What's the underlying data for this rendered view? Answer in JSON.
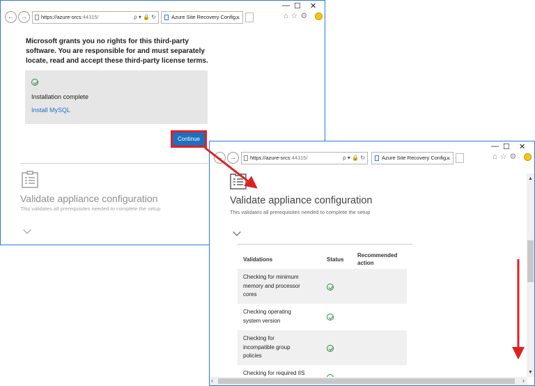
{
  "browser": {
    "url_host": "https://azure-srcs",
    "url_port": ":44315/",
    "url_tools": "ρ ▾ 🔒 ↻",
    "tab_title": "Azure Site Recovery Config...",
    "tab_close": "×",
    "nav_back": "←",
    "nav_forward": "→",
    "minimize": "—",
    "maximize": "☐",
    "close": "✕",
    "right_icons": "⌂☆⚙"
  },
  "install": {
    "license_text": "Microsoft grants you no rights for this third-party software. You are responsible for and must separately locate, read and accept these third-party license terms.",
    "status": "Installation complete",
    "install_link": "Install MySQL",
    "continue_label": "Continue"
  },
  "validate": {
    "title": "Validate appliance configuration",
    "subtitle": "This validates all prerequisites needed to complete the setup"
  },
  "table": {
    "headers": {
      "validations": "Validations",
      "status": "Status",
      "action_line1": "Recommended",
      "action_line2": "action"
    },
    "rows": [
      {
        "line1": "Checking for minimum",
        "line2": "memory and processor",
        "line3": "cores",
        "status": "passed"
      },
      {
        "line1": "Checking operating",
        "line2": "system version",
        "line3": "",
        "status": "passed"
      },
      {
        "line1": "Checking for",
        "line2": "incompatible group",
        "line3": "policies",
        "status": "passed"
      },
      {
        "line1": "Checking for required IIS",
        "line2": "",
        "line3": "",
        "status": "passed"
      }
    ]
  },
  "scrollbar": {
    "left_arrow": "‹",
    "right_arrow": "›",
    "up_arrow": "▲",
    "down_arrow": "▼"
  },
  "colors": {
    "window_border": "#2b79d4",
    "button_blue": "#1e6fbf",
    "highlight_red": "#e02020",
    "link_blue": "#2470c7",
    "check_green": "#2e8b3a",
    "status_panel": "#e6e6e6"
  }
}
